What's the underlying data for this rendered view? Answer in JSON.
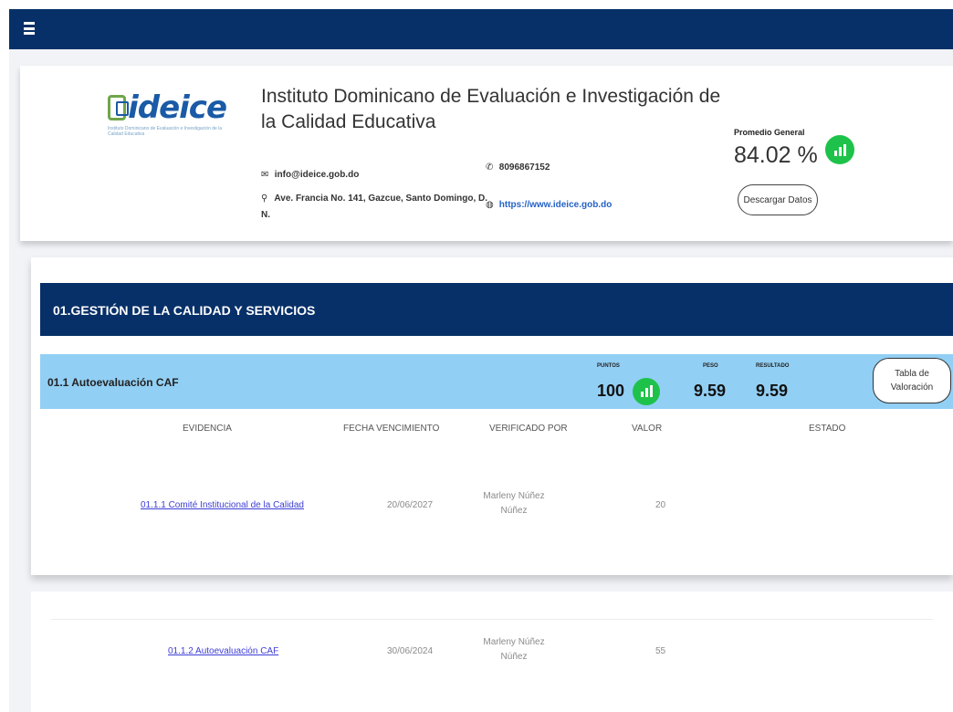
{
  "topbar": {
    "menu_icon": "hamburger-menu-icon"
  },
  "header": {
    "logo_text": "ideice",
    "logo_subtitle": "Instituto Dominicano de Evaluación e Investigación de la Calidad Educativa",
    "title": "Instituto Dominicano de Evaluación e Investigación de la Calidad Educativa",
    "email": "info@ideice.gob.do",
    "address": "Ave. Francia No. 141, Gazcue, Santo Domingo, D. N.",
    "phone": "8096867152",
    "website": "https://www.ideice.gob.do",
    "promedio_label": "Promedio General",
    "promedio_value": "84.02 %",
    "download_button": "Descargar Datos"
  },
  "section": {
    "title": "01.GESTIÓN DE LA CALIDAD Y SERVICIOS",
    "subsection": {
      "title": "01.1 Autoevaluación CAF",
      "puntos_label": "PUNTOS",
      "puntos_value": "100",
      "peso_label": "PESO",
      "peso_value": "9.59",
      "resultado_label": "RESULTADO",
      "resultado_value": "9.59",
      "tabla_button": "Tabla de Valoración"
    },
    "columns": [
      "EVIDENCIA",
      "FECHA VENCIMIENTO",
      "VERIFICADO POR",
      "VALOR",
      "ESTADO"
    ],
    "rows": [
      {
        "evidencia": "01.1.1 Comité Institucional de la Calidad",
        "fecha": "20/06/2027",
        "verificado": "Marleny Núñez Núñez",
        "valor": "20",
        "estado": ""
      },
      {
        "evidencia": "01.1.2 Autoevaluación CAF",
        "fecha": "30/06/2024",
        "verificado": "Marleny Núñez Núñez",
        "valor": "55",
        "estado": ""
      }
    ]
  },
  "colors": {
    "navy": "#073068",
    "light_blue": "#92cff4",
    "green": "#1ec24a",
    "link": "#3d3dd6"
  }
}
